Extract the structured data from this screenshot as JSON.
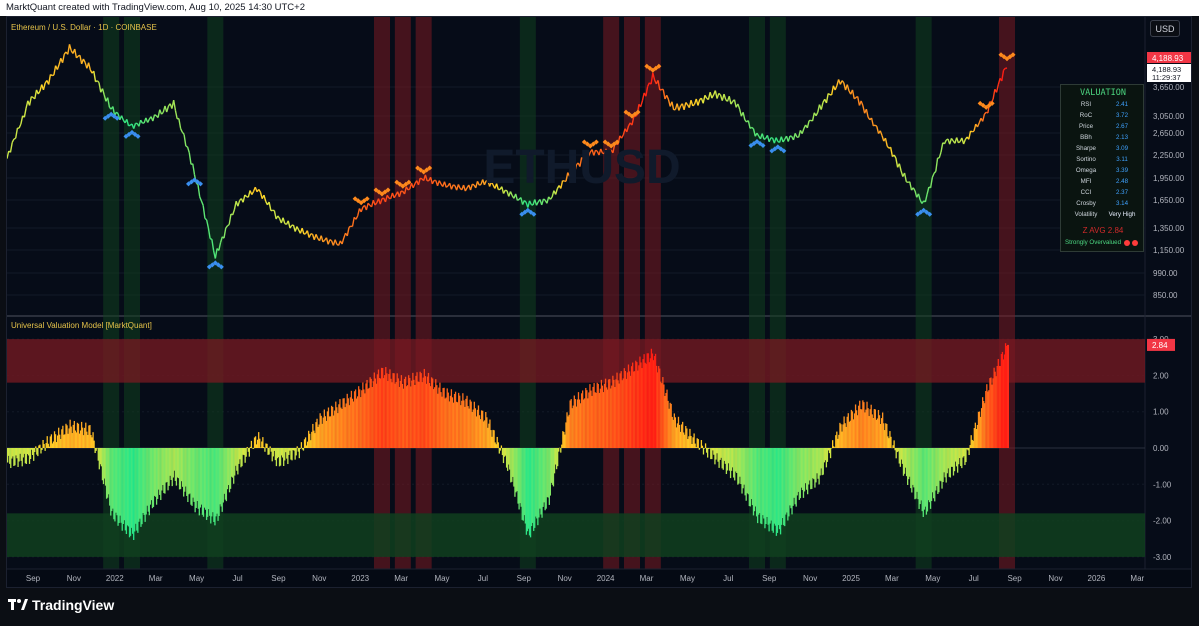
{
  "header": {
    "credit": "MarktQuant created with TradingView.com, Aug 10, 2025 14:30 UTC+2"
  },
  "price_pane": {
    "title": "Ethereum / U.S. Dollar · 1D · COINBASE",
    "watermark": "ETHUSD",
    "currency_button": "USD",
    "last_price_label": "4,188.93",
    "last_price_small": "4,188.93",
    "countdown": "11:29:37",
    "y_ticks": [
      "3,650.00",
      "3,050.00",
      "2,650.00",
      "2,250.00",
      "1,950.00",
      "1,650.00",
      "1,350.00",
      "1,150.00",
      "990.00",
      "850.00"
    ]
  },
  "valuation_table": {
    "title": "VALUATION",
    "rows": [
      {
        "k": "RSI",
        "v": "2.41"
      },
      {
        "k": "RoC",
        "v": "3.72"
      },
      {
        "k": "Price",
        "v": "2.67"
      },
      {
        "k": "BBh",
        "v": "2.13"
      },
      {
        "k": "Sharpe",
        "v": "3.09"
      },
      {
        "k": "Sortino",
        "v": "3.11"
      },
      {
        "k": "Omega",
        "v": "3.39"
      },
      {
        "k": "MFI",
        "v": "2.48"
      },
      {
        "k": "CCI",
        "v": "2.37"
      },
      {
        "k": "Crosby",
        "v": "3.14"
      },
      {
        "k": "Volatility",
        "v": "Very High"
      }
    ],
    "z_avg": "Z AVG 2.84",
    "status": "Strongly Overvalued"
  },
  "indicator_pane": {
    "title": "Universal Valuation Model [MarktQuant]",
    "last_value_label": "2.84",
    "y_ticks": [
      "3.00",
      "2.00",
      "1.00",
      "0.00",
      "-1.00",
      "-2.00",
      "-3.00"
    ]
  },
  "x_axis": {
    "labels": [
      "Sep",
      "Nov",
      "2022",
      "Mar",
      "May",
      "Jul",
      "Sep",
      "Nov",
      "2023",
      "Mar",
      "May",
      "Jul",
      "Sep",
      "Nov",
      "2024",
      "Mar",
      "May",
      "Jul",
      "Sep",
      "Nov",
      "2025",
      "Mar",
      "May",
      "Jul",
      "Sep",
      "Nov",
      "2026",
      "Mar"
    ]
  },
  "brand": "TradingView",
  "colors": {
    "background": "#050a14",
    "overvalued_band": "#7a1a22",
    "undervalued_band": "#10401f",
    "hot": "#ff2a1a",
    "cold": "#1fe08a",
    "buy_marker": "#3a8ff0",
    "sell_marker": "#ff8a1c"
  },
  "chart_data": [
    {
      "type": "line",
      "title": "Ethereum / U.S. Dollar · 1D · COINBASE",
      "ylabel": "",
      "x": [
        "2021-08",
        "2021-09",
        "2021-10",
        "2021-11",
        "2021-12",
        "2022-01",
        "2022-02",
        "2022-03",
        "2022-04",
        "2022-05",
        "2022-06",
        "2022-07",
        "2022-08",
        "2022-09",
        "2022-10",
        "2022-11",
        "2022-12",
        "2023-01",
        "2023-02",
        "2023-03",
        "2023-04",
        "2023-05",
        "2023-06",
        "2023-07",
        "2023-08",
        "2023-09",
        "2023-10",
        "2023-11",
        "2023-12",
        "2024-01",
        "2024-02",
        "2024-03",
        "2024-04",
        "2024-05",
        "2024-06",
        "2024-07",
        "2024-08",
        "2024-09",
        "2024-10",
        "2024-11",
        "2024-12",
        "2025-01",
        "2025-02",
        "2025-03",
        "2025-04",
        "2025-05",
        "2025-06",
        "2025-07",
        "2025-08"
      ],
      "series": [
        {
          "values": [
            2200,
            3300,
            3800,
            4650,
            4100,
            3200,
            2800,
            3000,
            3300,
            2000,
            1100,
            1600,
            1800,
            1450,
            1330,
            1250,
            1200,
            1550,
            1650,
            1750,
            1950,
            1850,
            1800,
            1900,
            1750,
            1600,
            1650,
            2000,
            2300,
            2300,
            2900,
            3900,
            3200,
            3300,
            3500,
            3300,
            2600,
            2500,
            2600,
            3200,
            3800,
            3300,
            2600,
            2000,
            1600,
            2500,
            2500,
            3100,
            4189
          ]
        }
      ],
      "ylim": [
        850,
        4600
      ],
      "scale": "log"
    },
    {
      "type": "bar",
      "title": "Universal Valuation Model [MarktQuant]",
      "x": [
        "2021-08",
        "2021-09",
        "2021-10",
        "2021-11",
        "2021-12",
        "2022-01",
        "2022-02",
        "2022-03",
        "2022-04",
        "2022-05",
        "2022-06",
        "2022-07",
        "2022-08",
        "2022-09",
        "2022-10",
        "2022-11",
        "2022-12",
        "2023-01",
        "2023-02",
        "2023-03",
        "2023-04",
        "2023-05",
        "2023-06",
        "2023-07",
        "2023-08",
        "2023-09",
        "2023-10",
        "2023-11",
        "2023-12",
        "2024-01",
        "2024-02",
        "2024-03",
        "2024-04",
        "2024-05",
        "2024-06",
        "2024-07",
        "2024-08",
        "2024-09",
        "2024-10",
        "2024-11",
        "2024-12",
        "2025-01",
        "2025-02",
        "2025-03",
        "2025-04",
        "2025-05",
        "2025-06",
        "2025-07",
        "2025-08"
      ],
      "series": [
        {
          "values": [
            -0.4,
            -0.3,
            0.2,
            0.6,
            0.5,
            -1.8,
            -2.4,
            -1.5,
            -0.8,
            -1.6,
            -2.0,
            -0.6,
            0.3,
            -0.4,
            -0.1,
            0.8,
            1.2,
            1.6,
            2.1,
            1.8,
            2.0,
            1.5,
            1.3,
            0.8,
            -0.5,
            -2.4,
            -1.4,
            1.2,
            1.6,
            1.8,
            2.2,
            2.6,
            0.8,
            0.2,
            -0.3,
            -0.8,
            -1.9,
            -2.3,
            -1.3,
            -0.8,
            0.6,
            1.2,
            0.8,
            -0.6,
            -1.8,
            -0.8,
            -0.3,
            1.6,
            2.84
          ]
        }
      ],
      "ylim": [
        -3.0,
        3.0
      ],
      "zones": {
        "overvalued": [
          1.8,
          3.0
        ],
        "undervalued": [
          -3.0,
          -1.8
        ]
      }
    }
  ]
}
